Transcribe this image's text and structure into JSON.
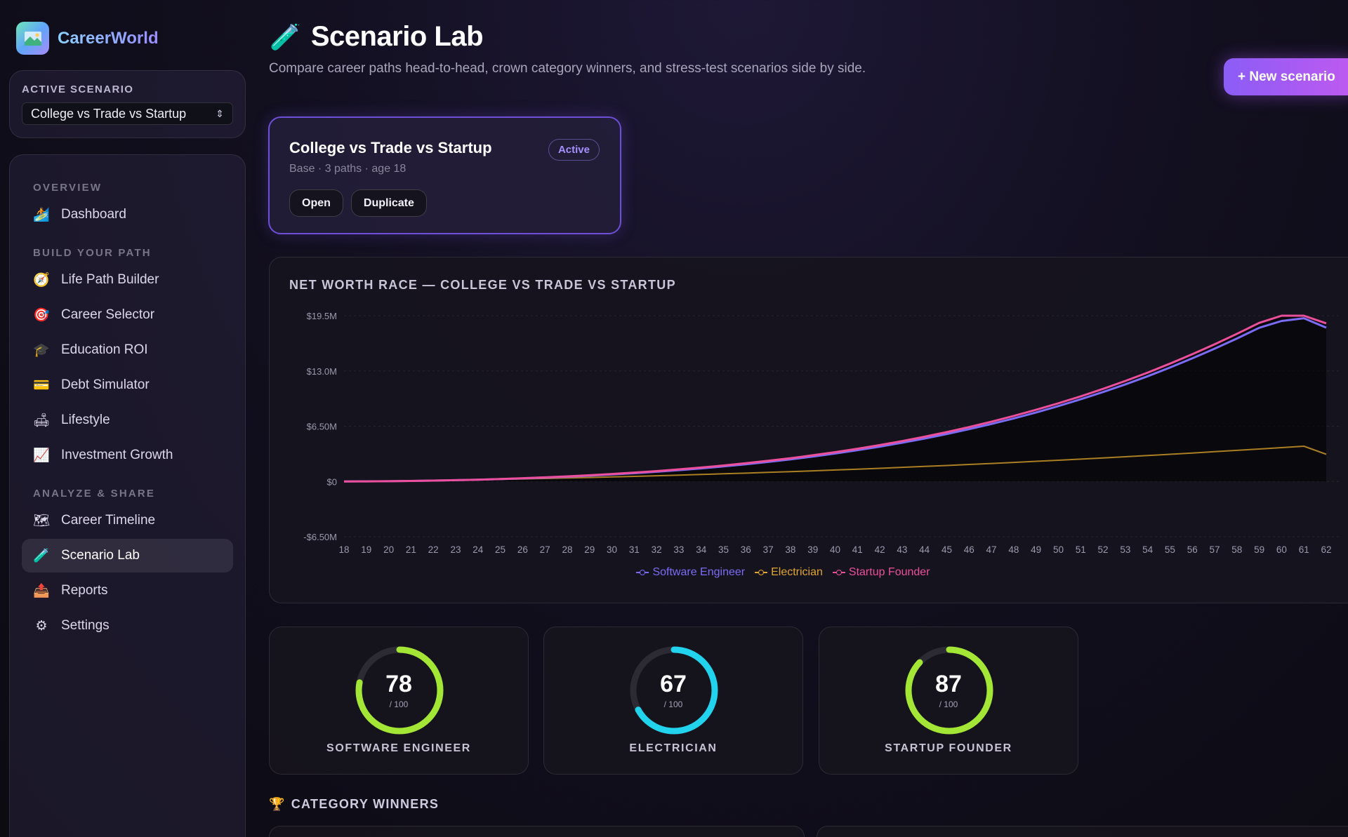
{
  "app": {
    "name": "CareerWorld",
    "logo_icon": "map-icon"
  },
  "sidebar": {
    "active_scenario_label": "ACTIVE SCENARIO",
    "active_scenario_value": "College vs Trade vs Startup",
    "sections": [
      {
        "label": "OVERVIEW",
        "items": [
          {
            "label": "Dashboard",
            "icon": "🏄"
          }
        ]
      },
      {
        "label": "BUILD YOUR PATH",
        "items": [
          {
            "label": "Life Path Builder",
            "icon": "🧭"
          },
          {
            "label": "Career Selector",
            "icon": "🎯"
          },
          {
            "label": "Education ROI",
            "icon": "🎓"
          },
          {
            "label": "Debt Simulator",
            "icon": "💳"
          },
          {
            "label": "Lifestyle",
            "icon": "🛋"
          },
          {
            "label": "Investment Growth",
            "icon": "📈"
          }
        ]
      },
      {
        "label": "ANALYZE & SHARE",
        "items": [
          {
            "label": "Career Timeline",
            "icon": "🗺"
          },
          {
            "label": "Scenario Lab",
            "icon": "🧪",
            "active": true
          },
          {
            "label": "Reports",
            "icon": "📤"
          },
          {
            "label": "Settings",
            "icon": "⚙"
          }
        ]
      }
    ]
  },
  "header": {
    "title_icon": "🧪",
    "title": "Scenario Lab",
    "subtitle": "Compare career paths head-to-head, crown category winners, and stress-test scenarios side by side.",
    "new_button": "+ New scenario"
  },
  "scenario_card": {
    "title": "College vs Trade vs Startup",
    "meta": "Base · 3 paths · age 18",
    "badge": "Active",
    "open_label": "Open",
    "duplicate_label": "Duplicate"
  },
  "chart_data": {
    "type": "line",
    "title": "NET WORTH RACE — COLLEGE VS TRADE VS STARTUP",
    "x": [
      18,
      19,
      20,
      21,
      22,
      23,
      24,
      25,
      26,
      27,
      28,
      29,
      30,
      31,
      32,
      33,
      34,
      35,
      36,
      37,
      38,
      39,
      40,
      41,
      42,
      43,
      44,
      45,
      46,
      47,
      48,
      49,
      50,
      51,
      52,
      53,
      54,
      55,
      56,
      57,
      58,
      59,
      60,
      61,
      62
    ],
    "y_ticks": [
      "$19.5M",
      "$13.0M",
      "$6.50M",
      "$0",
      "-$6.50M"
    ],
    "y_tick_values": [
      19.5,
      13.0,
      6.5,
      0,
      -6.5
    ],
    "ylim": [
      -6.5,
      19.5
    ],
    "y_unit": "$M",
    "grid": true,
    "legend_position": "bottom-center",
    "series": [
      {
        "name": "Software Engineer",
        "color": "#7b6cf6",
        "values": [
          0,
          0.01,
          0.03,
          0.06,
          0.1,
          0.15,
          0.21,
          0.28,
          0.36,
          0.45,
          0.56,
          0.68,
          0.82,
          0.97,
          1.14,
          1.33,
          1.54,
          1.77,
          2.02,
          2.3,
          2.6,
          2.93,
          3.29,
          3.68,
          4.1,
          4.56,
          5.05,
          5.58,
          6.15,
          6.76,
          7.42,
          8.12,
          8.87,
          9.67,
          10.52,
          11.42,
          12.38,
          13.4,
          14.48,
          15.62,
          16.82,
          18.08,
          18.88,
          19.2,
          18.1
        ]
      },
      {
        "name": "Electrician",
        "color": "#e0a62a",
        "values": [
          0,
          0.02,
          0.05,
          0.08,
          0.12,
          0.16,
          0.2,
          0.25,
          0.3,
          0.35,
          0.41,
          0.47,
          0.53,
          0.6,
          0.67,
          0.74,
          0.82,
          0.9,
          0.98,
          1.07,
          1.16,
          1.25,
          1.35,
          1.45,
          1.55,
          1.66,
          1.77,
          1.88,
          2.0,
          2.12,
          2.24,
          2.37,
          2.5,
          2.63,
          2.77,
          2.91,
          3.05,
          3.2,
          3.35,
          3.5,
          3.66,
          3.82,
          3.98,
          4.15,
          3.2
        ]
      },
      {
        "name": "Startup Founder",
        "color": "#ec4f9c",
        "values": [
          0,
          0.01,
          0.03,
          0.06,
          0.1,
          0.15,
          0.21,
          0.29,
          0.38,
          0.48,
          0.6,
          0.73,
          0.88,
          1.04,
          1.22,
          1.42,
          1.64,
          1.88,
          2.14,
          2.43,
          2.74,
          3.08,
          3.45,
          3.85,
          4.28,
          4.75,
          5.26,
          5.81,
          6.4,
          7.03,
          7.71,
          8.43,
          9.2,
          10.02,
          10.89,
          11.82,
          12.81,
          13.86,
          14.97,
          16.14,
          17.37,
          18.66,
          19.5,
          19.5,
          18.6
        ]
      }
    ]
  },
  "scores": [
    {
      "value": 78,
      "max": 100,
      "denominator": "/ 100",
      "label": "SOFTWARE ENGINEER",
      "color": "#a3e635"
    },
    {
      "value": 67,
      "max": 100,
      "denominator": "/ 100",
      "label": "ELECTRICIAN",
      "color": "#22d3ee"
    },
    {
      "value": 87,
      "max": 100,
      "denominator": "/ 100",
      "label": "STARTUP FOUNDER",
      "color": "#a3e635"
    }
  ],
  "category_winners": {
    "icon": "🏆",
    "title": "CATEGORY WINNERS"
  }
}
